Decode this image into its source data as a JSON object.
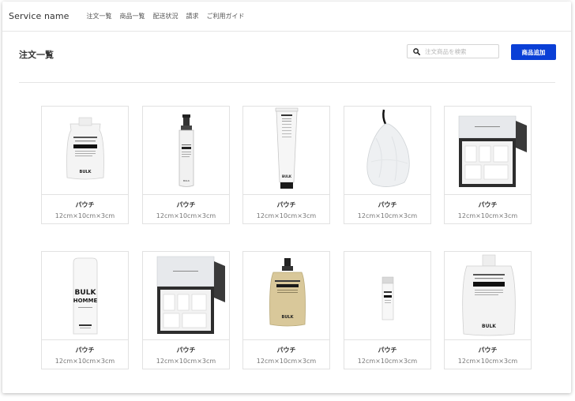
{
  "topbar": {
    "brand": "Service name",
    "nav": [
      "注文一覧",
      "商品一覧",
      "配送状況",
      "請求",
      "ご利用ガイド"
    ]
  },
  "header": {
    "title": "注文一覧",
    "search_placeholder": "注文商品を検索",
    "search_icon": "search-icon",
    "add_button": "商品追加"
  },
  "colors": {
    "accent": "#0a3fd6",
    "border": "#e2e2e2"
  },
  "products": [
    {
      "name": "パウチ",
      "size": "12cm×10cm×3cm",
      "image": "pouch-white"
    },
    {
      "name": "パウチ",
      "size": "12cm×10cm×3cm",
      "image": "pump-bottle"
    },
    {
      "name": "パウチ",
      "size": "12cm×10cm×3cm",
      "image": "tube"
    },
    {
      "name": "パウチ",
      "size": "12cm×10cm×3cm",
      "image": "foaming-net"
    },
    {
      "name": "パウチ",
      "size": "12cm×10cm×3cm",
      "image": "gift-box"
    },
    {
      "name": "パウチ",
      "size": "12cm×10cm×3cm",
      "image": "bulk-homme-bottle"
    },
    {
      "name": "パウチ",
      "size": "12cm×10cm×3cm",
      "image": "gift-box"
    },
    {
      "name": "パウチ",
      "size": "12cm×10cm×3cm",
      "image": "pouch-gold"
    },
    {
      "name": "パウチ",
      "size": "12cm×10cm×3cm",
      "image": "small-stick"
    },
    {
      "name": "パウチ",
      "size": "12cm×10cm×3cm",
      "image": "pouch-white-large"
    }
  ],
  "product_print": {
    "bulk": "BULK",
    "homme": "HOMME"
  }
}
